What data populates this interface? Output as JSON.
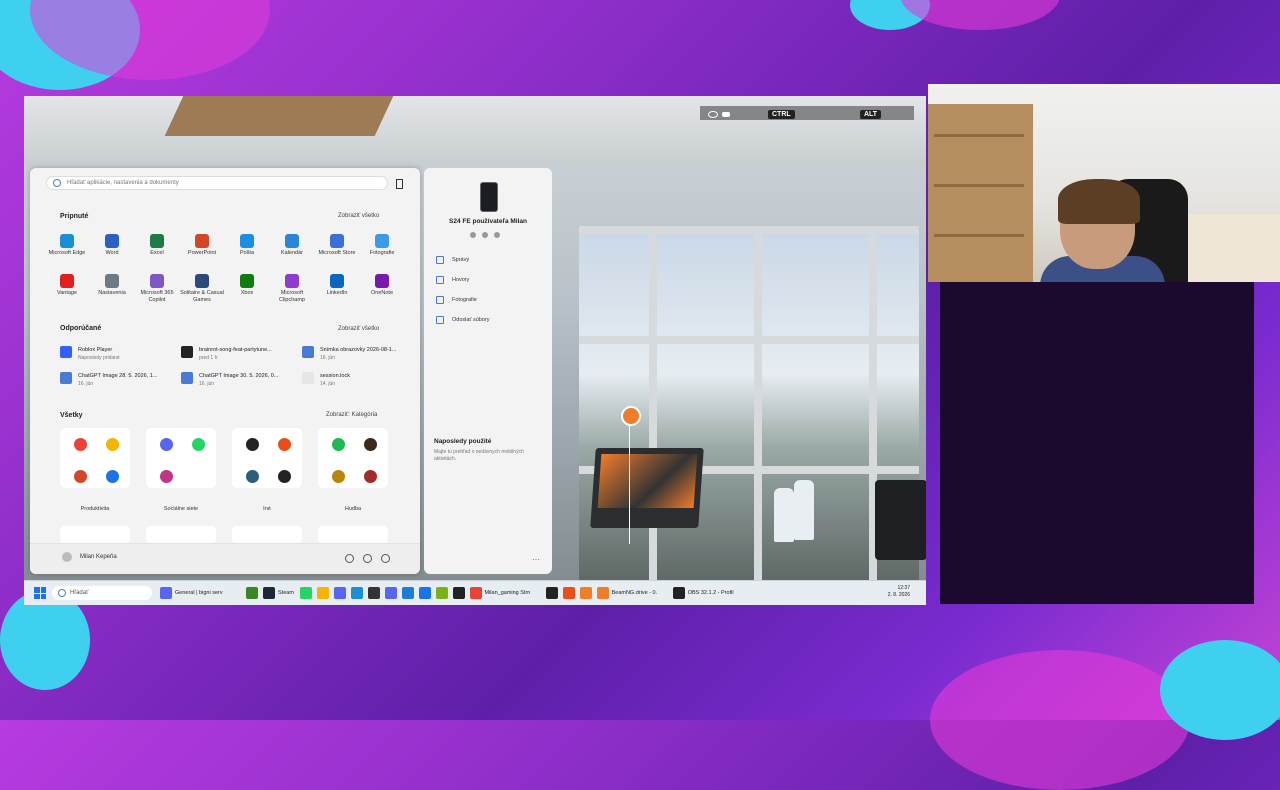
{
  "game": {
    "hud": {
      "ctrl": "CTRL",
      "alt": "ALT"
    }
  },
  "start_menu": {
    "search_placeholder": "Hľadať aplikácie, nastavenia a dokumenty",
    "pinned": {
      "title": "Pripnuté",
      "show_all": "Zobraziť všetko",
      "apps": [
        {
          "label": "Microsoft Edge",
          "color": "#1a8fd6"
        },
        {
          "label": "Word",
          "color": "#2b5fc4"
        },
        {
          "label": "Excel",
          "color": "#1e7b45"
        },
        {
          "label": "PowerPoint",
          "color": "#d24726"
        },
        {
          "label": "Pošta",
          "color": "#1d8fe0"
        },
        {
          "label": "Kalendár",
          "color": "#2a86d8"
        },
        {
          "label": "Microsoft Store",
          "color": "#3a6fd8"
        },
        {
          "label": "Fotografie",
          "color": "#3d9ae8"
        },
        {
          "label": "Vantage",
          "color": "#e02020"
        },
        {
          "label": "Nastavenia",
          "color": "#6d7a86"
        },
        {
          "label": "Microsoft 365 Copilot",
          "color": "#7e57c2"
        },
        {
          "label": "Solitaire & Casual Games",
          "color": "#2b4a7a"
        },
        {
          "label": "Xbox",
          "color": "#107c10"
        },
        {
          "label": "Microsoft Clipchamp",
          "color": "#8e3ccb"
        },
        {
          "label": "LinkedIn",
          "color": "#0a66c2"
        },
        {
          "label": "OneNote",
          "color": "#7719aa"
        }
      ]
    },
    "recommended": {
      "title": "Odporúčané",
      "show_all": "Zobraziť všetko",
      "items": [
        {
          "name": "Roblox Player",
          "sub": "Naposledy pridané",
          "color": "#335fff"
        },
        {
          "name": "brainrot-song-feat-partytune...",
          "sub": "pred 1 h",
          "color": "#222222"
        },
        {
          "name": "Snímka obrazovky 2026-08-1...",
          "sub": "16. jún",
          "color": "#4a7bd4"
        },
        {
          "name": "ChatGPT Image 28. 5. 2026, 1...",
          "sub": "16. jún",
          "color": "#4a7bd4"
        },
        {
          "name": "ChatGPT Image 30. 5. 2026, 0...",
          "sub": "16. jún",
          "color": "#4a7bd4"
        },
        {
          "name": "session.lock",
          "sub": "14. jún",
          "color": "#e6e6e6"
        }
      ]
    },
    "all": {
      "title": "Všetky",
      "view": "Zobraziť: Kategória",
      "folders": [
        {
          "label": "Produktivita",
          "colors": [
            "#ea4335",
            "#f4b400",
            "#d24726",
            "#1a73e8"
          ]
        },
        {
          "label": "Sociálne siete",
          "colors": [
            "#5865f2",
            "#25d366",
            "#c13584",
            "#ffffff"
          ]
        },
        {
          "label": "Iné",
          "colors": [
            "#222222",
            "#e94e1b",
            "#2b5f7a",
            "#222222"
          ]
        },
        {
          "label": "Hudba",
          "colors": [
            "#1db954",
            "#3a2a1e",
            "#b8860b",
            "#a52a2a"
          ]
        }
      ]
    },
    "user": "Milan Kepeňa"
  },
  "phone_link": {
    "device": "S24 FE používateľa Milan",
    "items": [
      "Správy",
      "Hovory",
      "Fotografie",
      "Odoslať súbory"
    ],
    "recent_title": "Naposledy použité",
    "recent_sub": "Majte tu prehľad o nedávnych mobilných aktivitách."
  },
  "taskbar": {
    "search": "Hľadať",
    "items": [
      {
        "label": "General | bigni serv",
        "color": "#5865f2"
      },
      {
        "label": "",
        "color": "#3c8527"
      },
      {
        "label": "Steam",
        "color": "#1b2838"
      },
      {
        "label": "",
        "color": "#25d366"
      },
      {
        "label": "",
        "color": "#f4b400"
      },
      {
        "label": "",
        "color": "#5865f2"
      },
      {
        "label": "",
        "color": "#1a8fd6"
      },
      {
        "label": "",
        "color": "#333333"
      },
      {
        "label": "",
        "color": "#5865f2"
      },
      {
        "label": "",
        "color": "#1e7bd6"
      },
      {
        "label": "",
        "color": "#1a73e8"
      },
      {
        "label": "",
        "color": "#7ab317"
      },
      {
        "label": "",
        "color": "#222222"
      },
      {
        "label": "Milan_gaming Strn",
        "color": "#ea4335"
      },
      {
        "label": "",
        "color": "#222222"
      },
      {
        "label": "",
        "color": "#e94e1b"
      },
      {
        "label": "",
        "color": "#f07d2a"
      },
      {
        "label": "BeamNG.drive - 0.",
        "color": "#f07d2a"
      },
      {
        "label": "OBS 32.1.2 - Profil",
        "color": "#222222"
      }
    ],
    "time": "12:37",
    "date": "2. 8. 2026"
  }
}
